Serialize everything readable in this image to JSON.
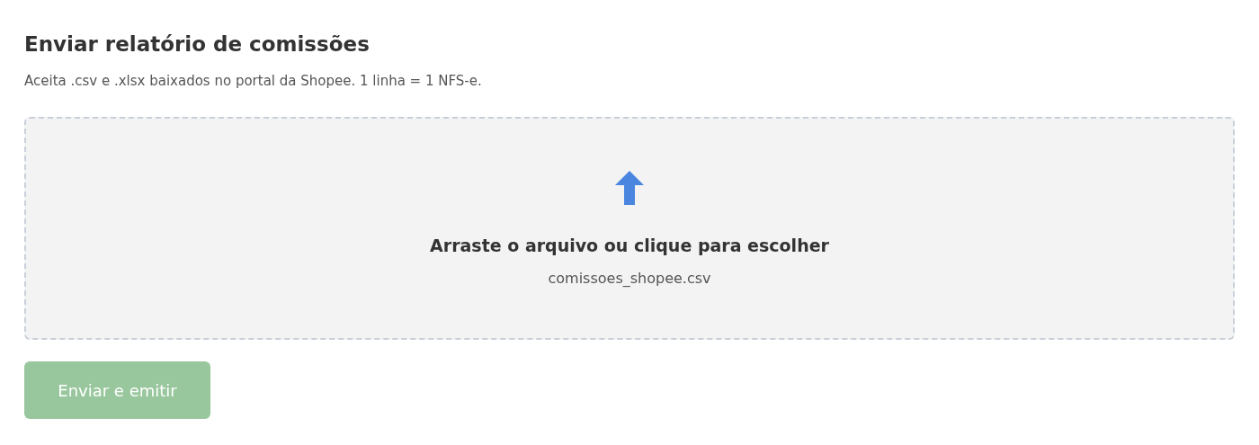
{
  "title": "Enviar relatório de comissões",
  "subtitle": "Aceita .csv e .xlsx baixados no portal da Shopee. 1 linha = 1 NFS-e.",
  "dropzone": {
    "prompt": "Arraste o arquivo ou clique para escolher",
    "file_name": "comissoes_shopee.csv"
  },
  "submit_button": {
    "label": "Enviar e emitir",
    "disabled": true
  }
}
